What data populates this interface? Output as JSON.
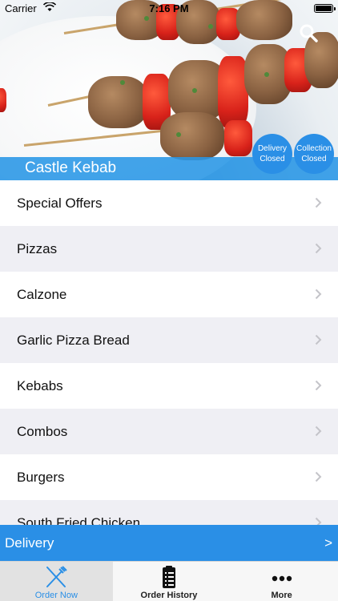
{
  "status_bar": {
    "carrier": "Carrier",
    "time": "7:16 PM"
  },
  "store": {
    "name": "Castle Kebab",
    "delivery_status": {
      "line1": "Delivery",
      "line2": "Closed"
    },
    "collection_status": {
      "line1": "Collection",
      "line2": "Closed"
    }
  },
  "menu": {
    "categories": [
      "Special Offers",
      "Pizzas",
      "Calzone",
      "Garlic Pizza Bread",
      "Kebabs",
      "Combos",
      "Burgers",
      "South Fried Chicken"
    ]
  },
  "order_mode": {
    "label": "Delivery",
    "arrow": ">"
  },
  "tabs": [
    {
      "label": "Order Now",
      "icon": "fork-knife-icon",
      "active": true
    },
    {
      "label": "Order History",
      "icon": "clipboard-list-icon",
      "active": false
    },
    {
      "label": "More",
      "icon": "more-dots-icon",
      "active": false
    }
  ],
  "colors": {
    "accent": "#2a8fe6",
    "list_alt": "#efeff4",
    "tabbar": "#f7f7f7"
  }
}
